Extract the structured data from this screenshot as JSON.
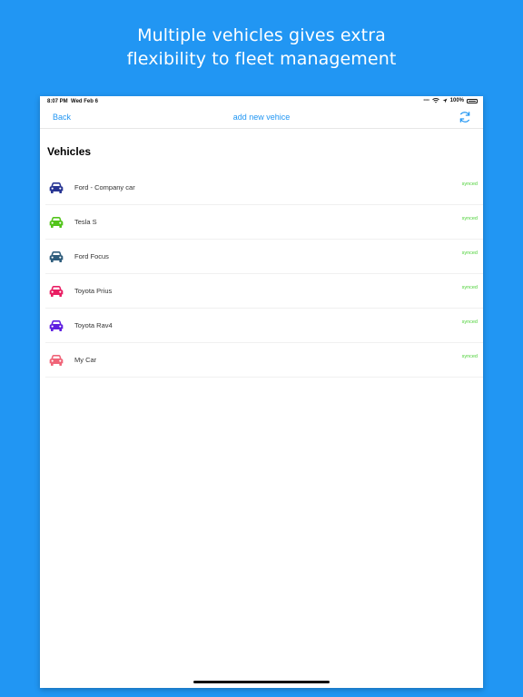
{
  "headline": {
    "line1": "Multiple vehicles gives extra",
    "line2": "flexibility to fleet management"
  },
  "status_bar": {
    "time": "8:07 PM",
    "date": "Wed Feb 6",
    "battery": "100%"
  },
  "nav": {
    "back_label": "Back",
    "title": "add new vehice",
    "refresh_icon": "refresh-icon"
  },
  "section": {
    "title": "Vehicles"
  },
  "vehicles": [
    {
      "name": "Ford - Company car",
      "status": "synced",
      "color": "#283593"
    },
    {
      "name": "Tesla S",
      "status": "synced",
      "color": "#52c41a"
    },
    {
      "name": "Ford Focus",
      "status": "synced",
      "color": "#2f5d7c"
    },
    {
      "name": "Toyota Prius",
      "status": "synced",
      "color": "#e91e63"
    },
    {
      "name": "Toyota Rav4",
      "status": "synced",
      "color": "#5e1ee0"
    },
    {
      "name": "My Car",
      "status": "synced",
      "color": "#f06478"
    }
  ],
  "colors": {
    "background": "#2196f3",
    "accent": "#2196f3",
    "synced": "#4cd137"
  }
}
